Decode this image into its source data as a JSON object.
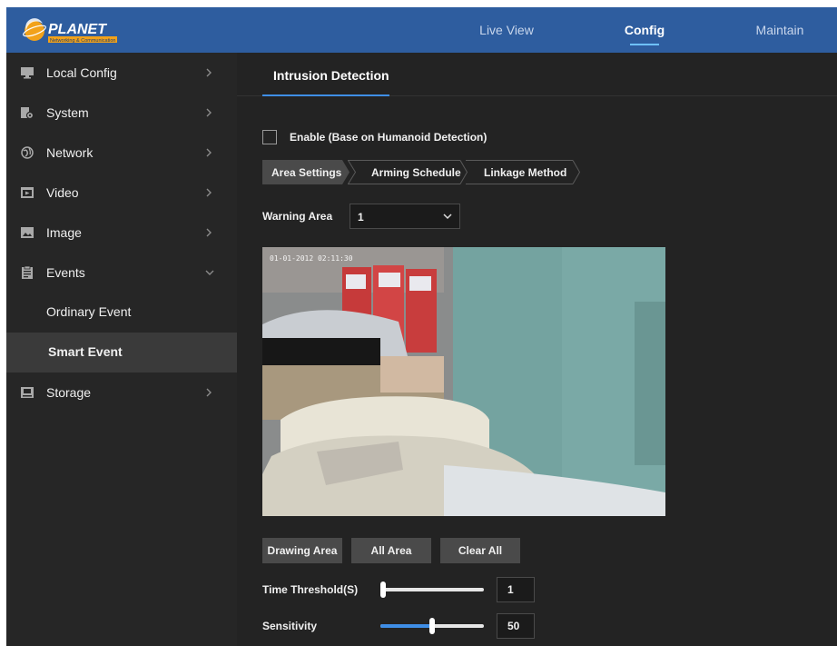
{
  "brand": {
    "logo_text": "PLANET",
    "logo_subtext": "Networking & Communication"
  },
  "top_nav": [
    {
      "label": "Live View",
      "active": false
    },
    {
      "label": "Config",
      "active": true
    },
    {
      "label": "Maintain",
      "active": false
    }
  ],
  "sidebar": {
    "items": [
      {
        "label": "Local Config",
        "icon": "monitor-icon"
      },
      {
        "label": "System",
        "icon": "system-gear-icon"
      },
      {
        "label": "Network",
        "icon": "globe-icon"
      },
      {
        "label": "Video",
        "icon": "video-icon"
      },
      {
        "label": "Image",
        "icon": "image-icon"
      },
      {
        "label": "Events",
        "icon": "clipboard-icon",
        "expanded": true
      },
      {
        "label": "Storage",
        "icon": "storage-icon"
      }
    ],
    "sub_items": [
      {
        "label": "Ordinary Event",
        "active": false
      },
      {
        "label": "Smart Event",
        "active": true
      }
    ]
  },
  "page": {
    "tab_title": "Intrusion Detection",
    "enable_label": "Enable (Base on Humanoid Detection)",
    "enable_checked": false,
    "steps": [
      {
        "label": "Area Settings",
        "active": true
      },
      {
        "label": "Arming Schedule",
        "active": false
      },
      {
        "label": "Linkage Method",
        "active": false
      }
    ],
    "warning_area": {
      "label": "Warning Area",
      "value": "1"
    },
    "video": {
      "timestamp": "01-01-2012 02:11:30"
    },
    "buttons": {
      "drawing_area": "Drawing Area",
      "all_area": "All Area",
      "clear_all": "Clear All"
    },
    "time_threshold": {
      "label": "Time Threshold(S)",
      "value": "1",
      "slider_fraction": 0.0
    },
    "sensitivity": {
      "label": "Sensitivity",
      "value": "50",
      "slider_fraction": 0.5
    }
  },
  "colors": {
    "topbar": "#2e5d9f",
    "accent": "#3f8ee6",
    "sidebar_bg": "#262626",
    "main_bg": "#232323"
  }
}
